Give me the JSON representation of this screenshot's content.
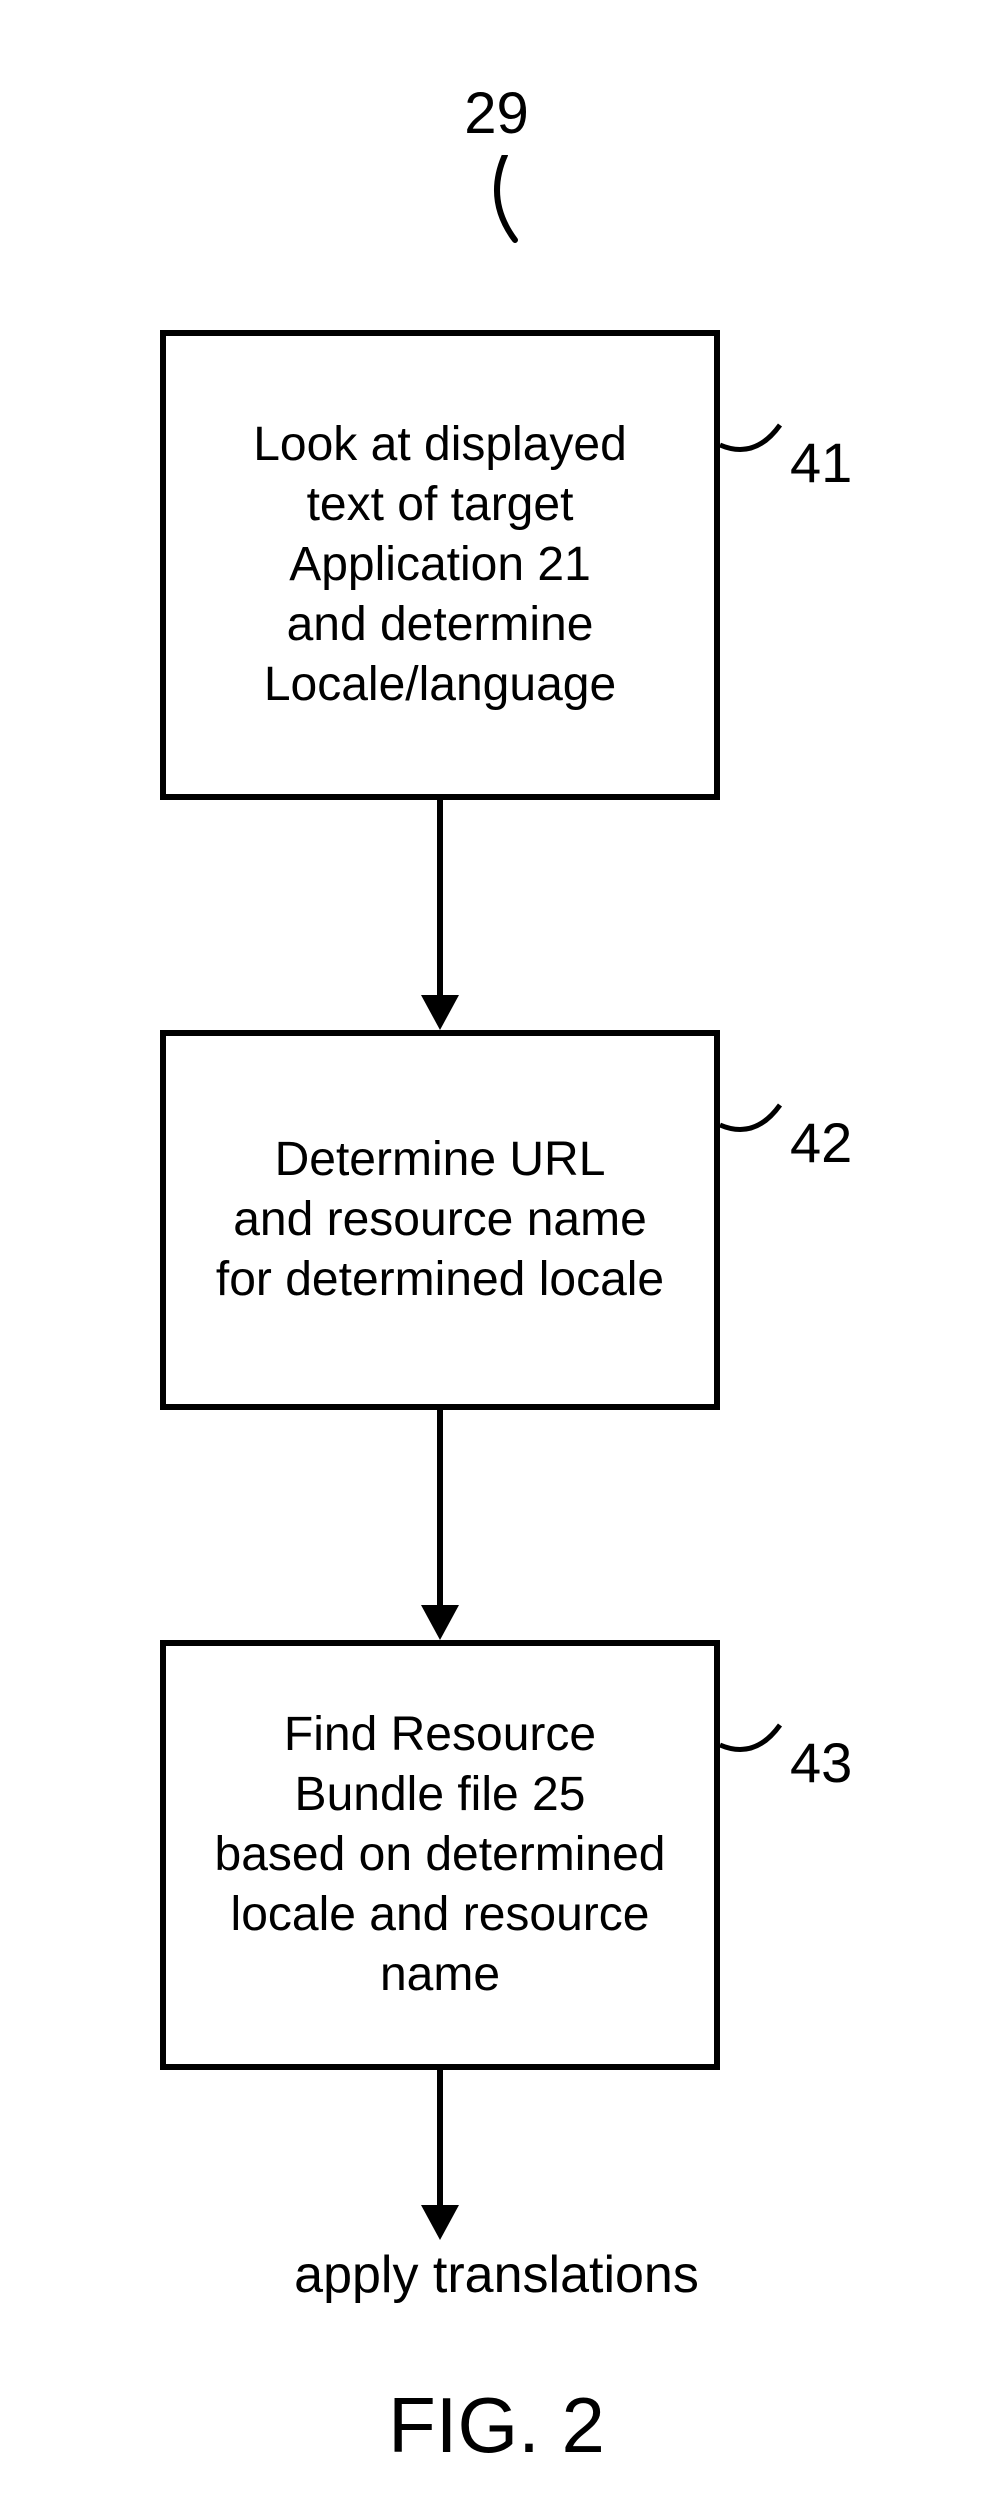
{
  "chart_data": {
    "type": "flowchart",
    "figure_number": 29,
    "figure_caption": "FIG. 2",
    "nodes": [
      {
        "id": 41,
        "text": "Look at displayed text of target Application 21 and determine Locale/language"
      },
      {
        "id": 42,
        "text": "Determine URL and resource name for determined locale"
      },
      {
        "id": 43,
        "text": "Find Resource Bundle file 25 based on determined locale and resource name"
      }
    ],
    "edges": [
      {
        "from": 41,
        "to": 42
      },
      {
        "from": 42,
        "to": 43
      },
      {
        "from": 43,
        "to": "apply translations"
      }
    ],
    "terminal": "apply translations"
  },
  "labels": {
    "top_ref": "29",
    "side1": "41",
    "side2": "42",
    "side3": "43"
  },
  "boxes": {
    "box1_text": "Look at displayed\ntext of target\nApplication 21\nand determine\nLocale/language",
    "box2_text": "Determine URL\nand resource name\nfor determined locale",
    "box3_text": "Find Resource\nBundle file 25\nbased on determined\nlocale and resource\nname"
  },
  "bottom": {
    "text": "apply translations"
  },
  "figure": {
    "caption": "FIG. 2"
  }
}
